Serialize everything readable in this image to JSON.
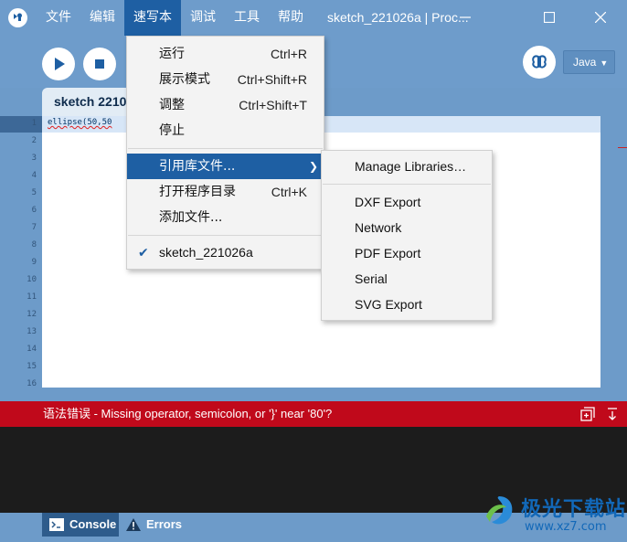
{
  "menubar": {
    "items": [
      "文件",
      "编辑",
      "速写本",
      "调试",
      "工具",
      "帮助"
    ],
    "active_index": 2
  },
  "window": {
    "title": "sketch_221026a | Proc..."
  },
  "toolbar": {
    "run_icon": "play-icon",
    "stop_icon": "stop-icon",
    "debug_icon": "butterfly-icon",
    "mode_label": "Java"
  },
  "tab": {
    "label": "sketch 2210"
  },
  "editor": {
    "line_numbers": [
      "1",
      "2",
      "3",
      "4",
      "5",
      "6",
      "7",
      "8",
      "9",
      "10",
      "11",
      "12",
      "13",
      "14",
      "15",
      "16"
    ],
    "code_line_1": "ellipse(50,50"
  },
  "error_bar": {
    "message": "语法错误 - Missing operator, semicolon, or '}' near '80'?"
  },
  "bottom_tabs": {
    "console": "Console",
    "errors": "Errors"
  },
  "sketch_menu": {
    "items": [
      {
        "label": "运行",
        "shortcut": "Ctrl+R"
      },
      {
        "label": "展示模式",
        "shortcut": "Ctrl+Shift+R"
      },
      {
        "label": "调整",
        "shortcut": "Ctrl+Shift+T"
      },
      {
        "label": "停止",
        "shortcut": ""
      },
      {
        "label": "引用库文件...",
        "shortcut": ""
      },
      {
        "label": "打开程序目录",
        "shortcut": "Ctrl+K"
      },
      {
        "label": "添加文件...",
        "shortcut": ""
      },
      {
        "label": "sketch_221026a",
        "shortcut": ""
      }
    ]
  },
  "library_submenu": {
    "items": [
      "Manage Libraries…",
      "DXF Export",
      "Network",
      "PDF Export",
      "Serial",
      "SVG Export"
    ]
  },
  "watermark": {
    "name": "极光下载站",
    "url": "www.xz7.com"
  },
  "colors": {
    "chrome_blue": "#6e9ccb",
    "menu_highlight": "#1e5fa3",
    "error_red": "#c0091b"
  }
}
